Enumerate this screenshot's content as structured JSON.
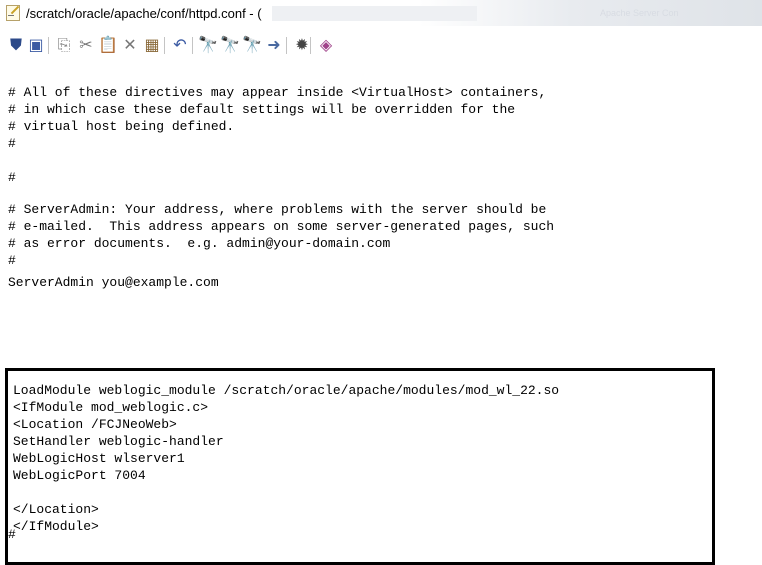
{
  "window": {
    "title": "/scratch/oracle/apache/conf/httpd.conf - (",
    "title_right": "Apache Server Con"
  },
  "toolbar": {
    "items": [
      {
        "name": "save-all-icon",
        "glyph": "⛊"
      },
      {
        "name": "save-icon",
        "glyph": "▣"
      },
      {
        "name": "copy-icon",
        "glyph": "⎘"
      },
      {
        "name": "cut-icon",
        "glyph": "✂"
      },
      {
        "name": "paste-icon",
        "glyph": "📋"
      },
      {
        "name": "delete-icon",
        "glyph": "✕"
      },
      {
        "name": "select-all-icon",
        "glyph": "▦"
      },
      {
        "name": "undo-icon",
        "glyph": "↶"
      },
      {
        "name": "find-icon",
        "glyph": "🔭"
      },
      {
        "name": "replace-icon",
        "glyph": "🔭"
      },
      {
        "name": "find-next-icon",
        "glyph": "🔭"
      },
      {
        "name": "goto-icon",
        "glyph": "➜"
      },
      {
        "name": "settings-icon",
        "glyph": "✹"
      },
      {
        "name": "help-icon",
        "glyph": "◈"
      }
    ]
  },
  "editor": {
    "lines": [
      "# All of these directives may appear inside <VirtualHost> containers,",
      "# in which case these default settings will be overridden for the",
      "# virtual host being defined.",
      "#",
      "",
      "#",
      "# ServerAdmin: Your address, where problems with the server should be",
      "# e-mailed.  This address appears on some server-generated pages, such",
      "# as error documents.  e.g. admin@your-domain.com",
      "#",
      "ServerAdmin you@example.com"
    ],
    "highlighted": [
      "LoadModule weblogic_module /scratch/oracle/apache/modules/mod_wl_22.so",
      "<IfModule mod_weblogic.c>",
      "<Location /FCJNeoWeb>",
      "SetHandler weblogic-handler",
      "WebLogicHost wlserver1",
      "WebLogicPort 7004",
      "",
      "</Location>",
      "</IfModule>"
    ],
    "after": "#"
  }
}
